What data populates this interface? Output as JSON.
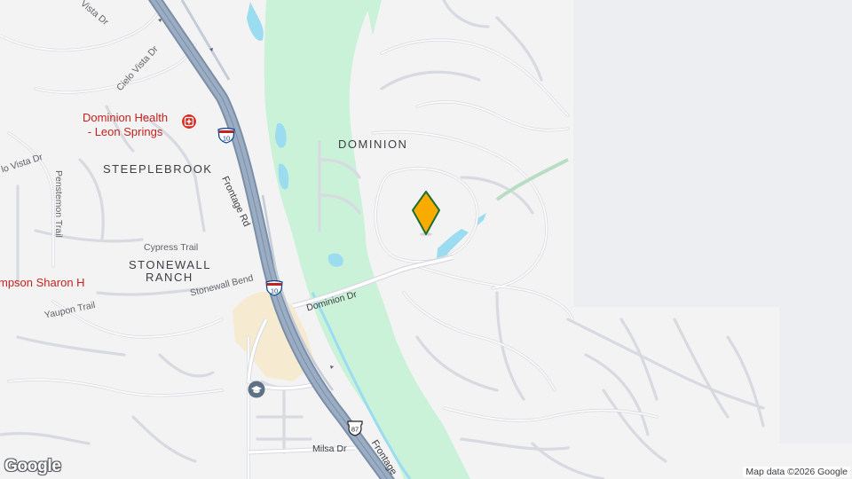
{
  "map": {
    "area_labels": {
      "dominion": "DOMINION",
      "steeplebrook": "STEEPLEBROOK",
      "stonewall_ranch_1": "STONEWALL",
      "stonewall_ranch_2": "RANCH"
    },
    "streets": {
      "frontage_rd_north": "Frontage Rd",
      "frontage_rd_south": "Frontage",
      "dominion_dr": "Dominion Dr",
      "cypress_trail": "Cypress Trail",
      "stonewall_bend": "Stonewall Bend",
      "yaupon_trail": "Yaupon Trail",
      "penstemon_trail": "Penstemon Trail",
      "cielo_vista_dr": "Cielo Vista Dr",
      "vista_dr_west": "lo Vista Dr",
      "vista_dr_top": "Vista Dr",
      "milsa_dr": "Milsa Dr"
    },
    "pois": {
      "hospital_line1": "Dominion Health",
      "hospital_line2": "- Leon Springs",
      "pharmacy_partial": "mpson Sharon H"
    },
    "shields": {
      "i10_north": "10",
      "i10_south": "10",
      "us87": "87"
    },
    "colors": {
      "land": "#f4f3f4",
      "park": "#c9f2d9",
      "water": "#9cdcf0",
      "campus": "#f6ead0",
      "highway": "#8ea1b8",
      "road": "#ffffff",
      "road_outline": "#d7dae0",
      "marker": "#f9ab00",
      "marker_outline": "#1e6e33",
      "poi_red": "#c5221f"
    },
    "marker": {
      "icon": "location-pin-icon"
    },
    "attribution": "Map data ©2026 Google",
    "logo": "Google"
  }
}
